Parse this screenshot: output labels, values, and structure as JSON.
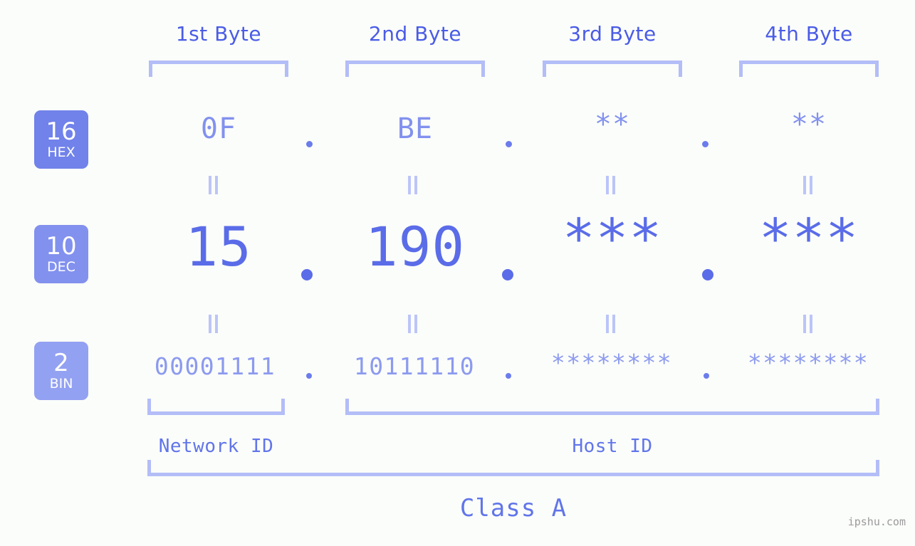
{
  "page": {
    "background_color": "#fbfdfa",
    "accent_color": "#5a6ce8",
    "light_accent_color": "#b3bdf7",
    "watermark": "ipshu.com"
  },
  "byte_headers": [
    {
      "label": "1st Byte"
    },
    {
      "label": "2nd Byte"
    },
    {
      "label": "3rd Byte"
    },
    {
      "label": "4th Byte"
    }
  ],
  "radix_badges": [
    {
      "number": "16",
      "name": "HEX",
      "color": "#7182ea"
    },
    {
      "number": "10",
      "name": "DEC",
      "color": "#8291ee"
    },
    {
      "number": "2",
      "name": "BIN",
      "color": "#93a1f2"
    }
  ],
  "rows": {
    "hex": {
      "radix": "16",
      "radix_name": "HEX",
      "values": [
        "0F",
        "BE",
        "**",
        "**"
      ],
      "separator": "."
    },
    "dec": {
      "radix": "10",
      "radix_name": "DEC",
      "values": [
        "15",
        "190",
        "***",
        "***"
      ],
      "separator": "."
    },
    "bin": {
      "radix": "2",
      "radix_name": "BIN",
      "values": [
        "00001111",
        "10111110",
        "********",
        "********"
      ],
      "separator": "."
    }
  },
  "equals_marks": {
    "glyph": "=",
    "count_per_row_gap": 4
  },
  "segments": {
    "network_id": "Network ID",
    "host_id": "Host ID",
    "class": "Class A"
  }
}
